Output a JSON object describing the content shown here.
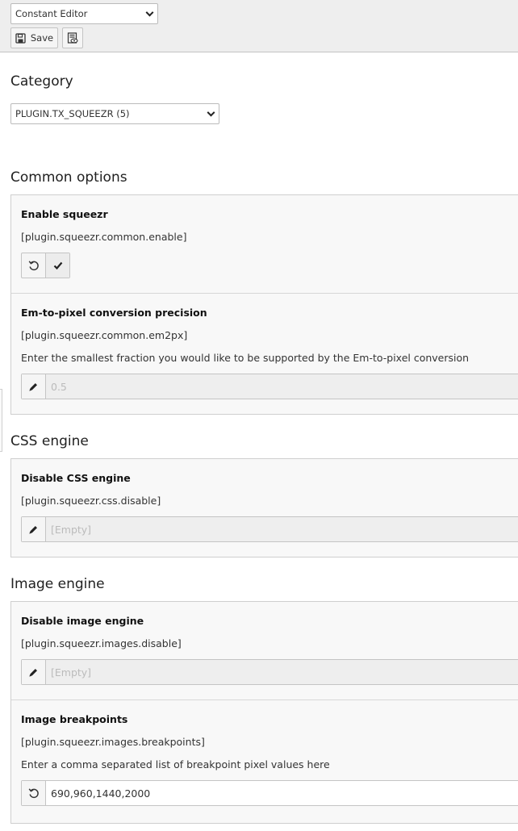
{
  "toolbar": {
    "module_select": "Constant Editor",
    "save_label": "Save"
  },
  "category": {
    "heading": "Category",
    "select_value": "PLUGIN.TX_SQUEEZR (5)"
  },
  "sections": [
    {
      "heading": "Common options",
      "items": [
        {
          "title": "Enable squeezr",
          "key": "[plugin.squeezr.common.enable]",
          "control": "toggle"
        },
        {
          "title": "Em-to-pixel conversion precision",
          "key": "[plugin.squeezr.common.em2px]",
          "description": "Enter the smallest fraction you would like to be supported by the Em-to-pixel conversion",
          "value": "0.5"
        }
      ]
    },
    {
      "heading": "CSS engine",
      "items": [
        {
          "title": "Disable CSS engine",
          "key": "[plugin.squeezr.css.disable]",
          "value": "[Empty]"
        }
      ]
    },
    {
      "heading": "Image engine",
      "items": [
        {
          "title": "Disable image engine",
          "key": "[plugin.squeezr.images.disable]",
          "value": "[Empty]"
        },
        {
          "title": "Image breakpoints",
          "key": "[plugin.squeezr.images.breakpoints]",
          "description": "Enter a comma separated list of breakpoint pixel values here",
          "value": "690,960,1440,2000"
        }
      ]
    }
  ],
  "colors": {
    "toolbar_bg": "#eeeeee",
    "panel_bg": "#f8f8f8",
    "disabled_input_bg": "#eeeeee"
  },
  "icons": [
    "chevron-down-icon",
    "save-icon",
    "view-icon",
    "undo-icon",
    "check-icon",
    "pencil-icon"
  ]
}
